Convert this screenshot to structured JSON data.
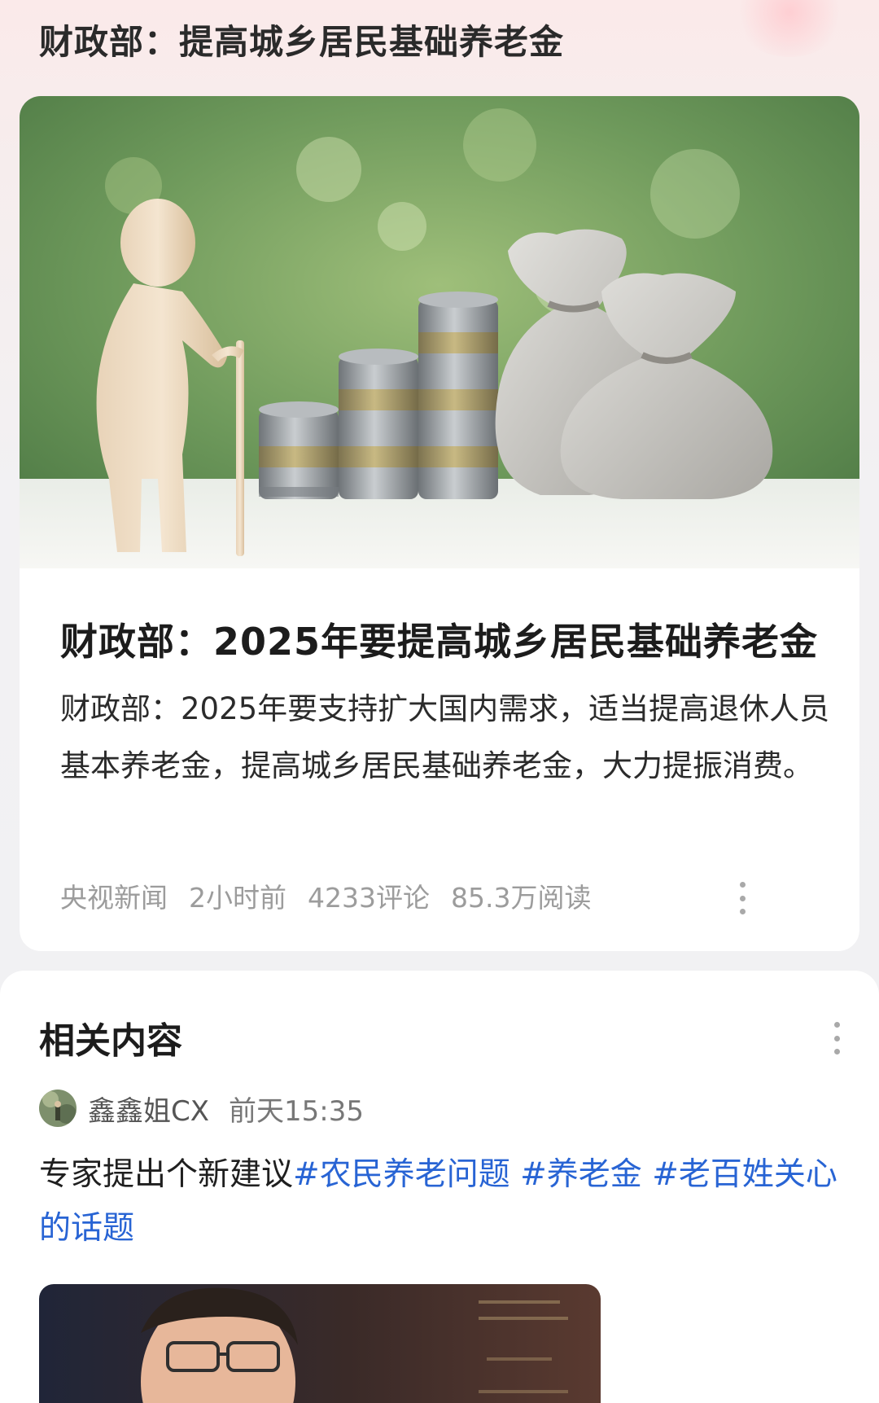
{
  "page_title": "财政部：提高城乡居民基础养老金",
  "article": {
    "title": "财政部：2025年要提高城乡居民基础养老金",
    "summary": "财政部：2025年要支持扩大国内需求，适当提高退休人员基本养老金，提高城乡居民基础养老金，大力提振消费。",
    "source": "央视新闻",
    "time": "2小时前",
    "comments": "4233评论",
    "reads": "85.3万阅读"
  },
  "related": {
    "title": "相关内容",
    "author": "鑫鑫姐CX",
    "time": "前天15:35",
    "text": "专家提出个新建议",
    "tags": [
      "#农民养老问题",
      "#养老金",
      "#老百姓关心的话题"
    ]
  },
  "icons": [
    "more-icon",
    "avatar"
  ],
  "colors": {
    "tag": "#2864d4",
    "meta": "#9c9c9c"
  }
}
